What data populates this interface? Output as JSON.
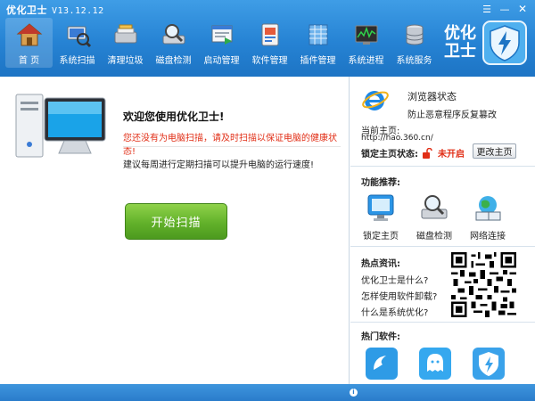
{
  "window": {
    "title": "优化卫士",
    "version": "V13.12.12"
  },
  "toolbar": {
    "items": [
      {
        "label": "首  页",
        "icon": "home-icon"
      },
      {
        "label": "系统扫描",
        "icon": "scan-icon"
      },
      {
        "label": "清理垃圾",
        "icon": "clean-icon"
      },
      {
        "label": "磁盘检测",
        "icon": "disk-check-icon"
      },
      {
        "label": "启动管理",
        "icon": "startup-icon"
      },
      {
        "label": "软件管理",
        "icon": "software-icon"
      },
      {
        "label": "插件管理",
        "icon": "plugin-icon"
      },
      {
        "label": "系统进程",
        "icon": "process-icon"
      },
      {
        "label": "系统服务",
        "icon": "service-icon"
      }
    ]
  },
  "brand": {
    "text_line1": "优化",
    "text_line2": "卫士"
  },
  "main": {
    "welcome": "欢迎您使用优化卫士!",
    "warning": "您还没有为电脑扫描，请及时扫描以保证电脑的健康状态!",
    "suggestion": "建议每周进行定期扫描可以提升电脑的运行速度!",
    "scan_button": "开始扫描"
  },
  "browser": {
    "title": "浏览器状态",
    "subtitle": "防止恶意程序反复篡改",
    "current_label": "当前主页:",
    "current_url": "http://hao.360.cn/",
    "lock_label": "锁定主页状态:",
    "lock_state": "未开启",
    "change_button": "更改主页"
  },
  "recommend": {
    "title": "功能推荐:",
    "items": [
      {
        "label": "锁定主页"
      },
      {
        "label": "磁盘检测"
      },
      {
        "label": "网络连接"
      }
    ]
  },
  "news": {
    "title": "热点资讯:",
    "items": [
      "优化卫士是什么?",
      "怎样使用软件卸载?",
      "什么是系统优化?"
    ]
  },
  "hot": {
    "title": "热门软件:"
  },
  "colors": {
    "toolbar_blue": "#2683d4",
    "warning_red": "#e12e16",
    "scan_green": "#62b12a"
  }
}
